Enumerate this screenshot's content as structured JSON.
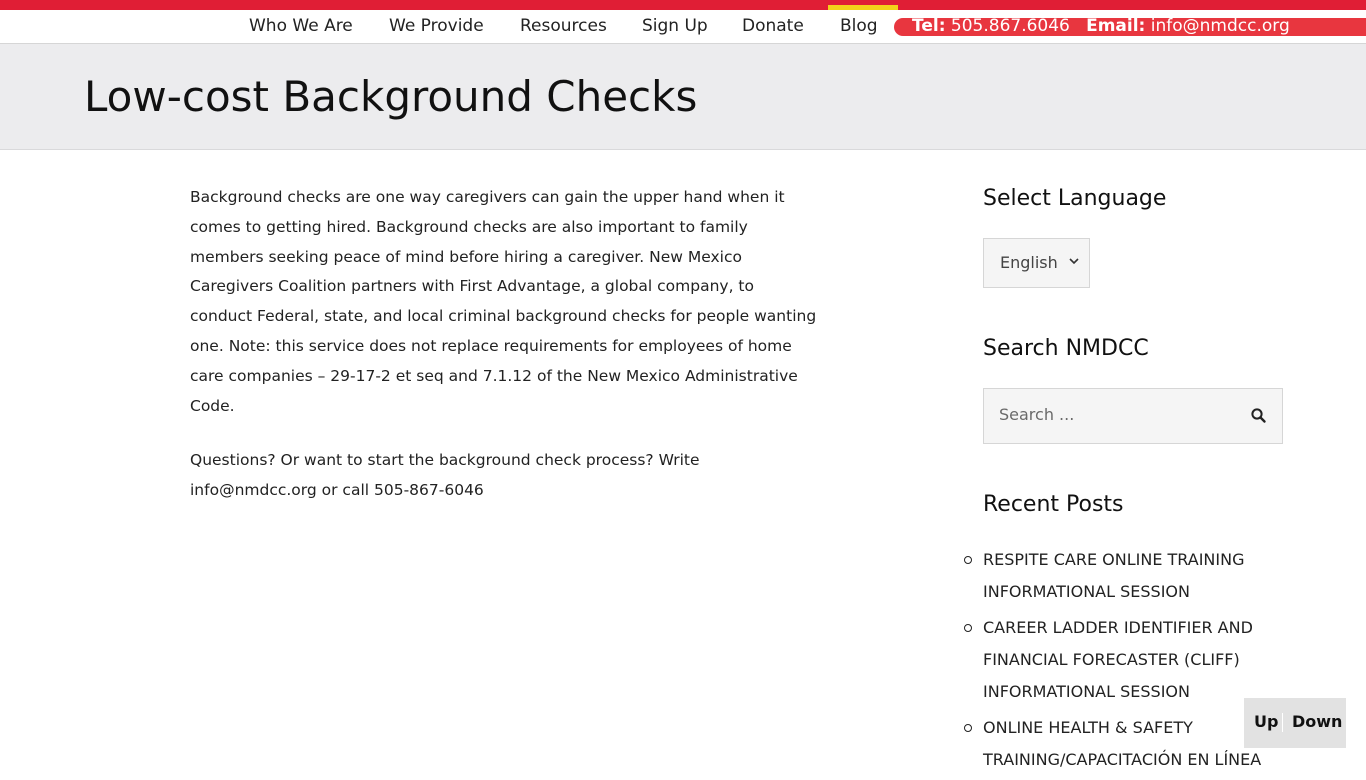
{
  "nav": {
    "items": [
      "Who We Are",
      "We Provide",
      "Resources",
      "Sign Up",
      "Donate",
      "Blog"
    ],
    "contact": {
      "tel_label": "Tel:",
      "tel": "505.867.6046",
      "email_label": "Email:",
      "email": "info@nmdcc.org"
    }
  },
  "page": {
    "title": "Low-cost Background Checks"
  },
  "content": {
    "paragraphs": [
      "Background checks are one way caregivers can gain the upper hand when it comes to getting hired. Background checks are also important to family members seeking peace of mind before hiring a caregiver. New Mexico Caregivers Coalition partners with First Advantage, a global company, to conduct Federal, state, and local criminal background checks for people wanting one. Note: this service does not replace requirements for employees of home care companies – 29-17-2 et seq and 7.1.12 of the New Mexico Administrative Code.",
      "Questions? Or want to start the background check process? Write info@nmdcc.org or call 505-867-6046"
    ]
  },
  "sidebar": {
    "language": {
      "title": "Select Language",
      "selected": "English"
    },
    "search": {
      "title": "Search NMDCC",
      "placeholder": "Search ..."
    },
    "recent_posts": {
      "title": "Recent Posts",
      "items": [
        "RESPITE CARE ONLINE TRAINING INFORMATIONAL SESSION",
        "CAREER LADDER IDENTIFIER AND FINANCIAL FORECASTER (CLIFF) INFORMATIONAL SESSION",
        "ONLINE HEALTH & SAFETY TRAINING/CAPACITACIÓN EN LÍNEA"
      ]
    }
  },
  "scroll_nav": {
    "up": "Up",
    "down": "Down"
  },
  "colors": {
    "brand_red": "#e01e35",
    "contact_red": "#e8363f",
    "active_yellow": "#f3d11a",
    "hero_gray": "#ececee"
  }
}
